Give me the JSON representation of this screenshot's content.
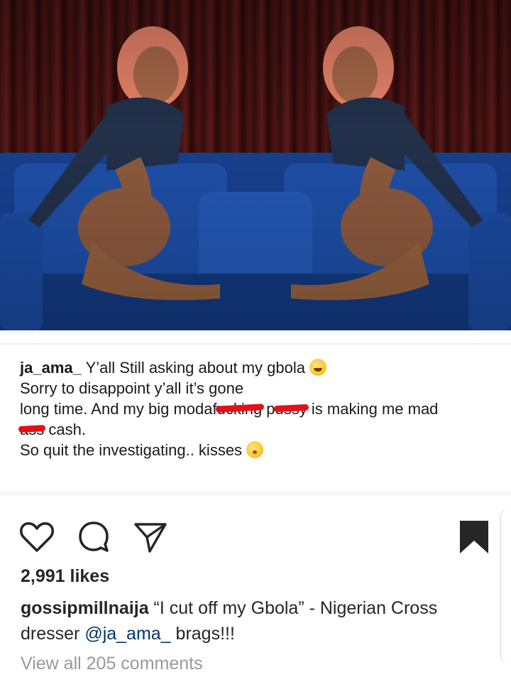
{
  "embedded_comment": {
    "username": "ja_ama_",
    "line1": " Y’all Still asking about my gbola ",
    "line2": "Sorry to disappoint y’all it’s gone",
    "line3_a": "long time. And my big modaf",
    "line3_redact1": "ucking",
    "line3_b": " p",
    "line3_redact2": "ussy",
    "line3_c": " is making me mad",
    "line4_redact": "ass",
    "line4_a": " cash.",
    "line5": "So quit the investigating.. kisses ",
    "emoji1": "rolling-laughing-emoji",
    "emoji2": "kissing-face-emoji"
  },
  "actions": {
    "like_icon": "heart-icon",
    "comment_icon": "comment-bubble-icon",
    "share_icon": "paper-plane-icon",
    "save_icon": "bookmark-icon"
  },
  "post": {
    "likes": "2,991 likes",
    "owner": "gossipmillnaija",
    "caption_a": " “I cut off my Gbola” - Nigerian Cross dresser ",
    "mention": "@ja_ama_",
    "caption_b": " brags!!!",
    "view_comments": "View all 205 comments"
  },
  "colors": {
    "text": "#262626",
    "muted": "#999999",
    "mention": "#003569",
    "redaction": "#e3101a",
    "curtain": "#4b1514",
    "sofa": "#1e4fa8"
  }
}
